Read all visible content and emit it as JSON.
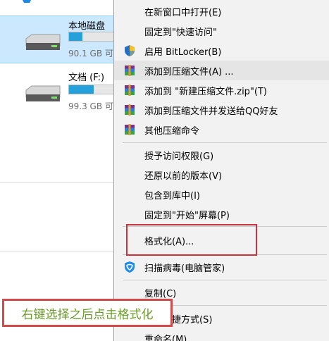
{
  "drives": [
    {
      "name": "本地磁盘",
      "size_text": "90.1 GB 可",
      "fill_fraction": 0.3,
      "selected": true
    },
    {
      "name": "文档 (F:)",
      "size_text": "99.3 GB 可",
      "fill_fraction": 0.55,
      "selected": false
    }
  ],
  "menu": {
    "items": [
      {
        "label": "在新窗口中打开(E)",
        "icon": ""
      },
      {
        "label": "固定到\"快速访问\"",
        "icon": ""
      },
      {
        "label": "启用 BitLocker(B)",
        "icon": "bitlocker-shield-icon"
      },
      {
        "label": "添加到压缩文件(A) ...",
        "icon": "winrar-icon",
        "hover": true
      },
      {
        "label": "添加到 \"新建压缩文件.zip\"(T)",
        "icon": "winrar-icon"
      },
      {
        "label": "添加到压缩文件并发送给QQ好友",
        "icon": "winrar-icon"
      },
      {
        "label": "其他压缩命令",
        "icon": "winrar-icon"
      },
      {
        "label": "授予访问权限(G)",
        "icon": ""
      },
      {
        "label": "还原以前的版本(V)",
        "icon": ""
      },
      {
        "label": "包含到库中(I)",
        "icon": ""
      },
      {
        "label": "固定到\"开始\"屏幕(P)",
        "icon": ""
      },
      {
        "label": "格式化(A)...",
        "icon": ""
      },
      {
        "label": "扫描病毒(电脑管家)",
        "icon": "tencent-pc-manager-icon"
      },
      {
        "label": "复制(C)",
        "icon": ""
      },
      {
        "label": "创建快捷方式(S)",
        "icon": ""
      },
      {
        "label": "重命名(M)",
        "icon": ""
      }
    ]
  },
  "annotation": {
    "text": "右键选择之后点击格式化"
  },
  "colors": {
    "selection": "#cce8ff",
    "capacity_bar": "#26a0da",
    "highlight_border": "#c7353a",
    "annotation_text": "#6a9a2a"
  }
}
